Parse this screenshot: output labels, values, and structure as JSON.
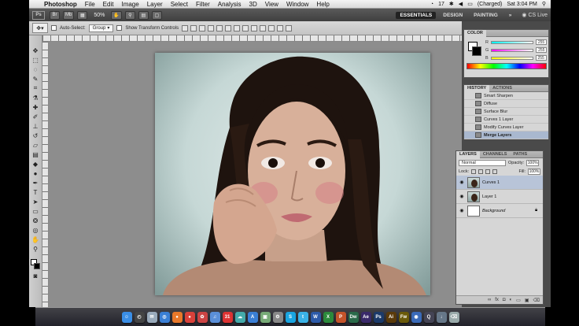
{
  "menubar": {
    "app_name": "Photoshop",
    "items": [
      "File",
      "Edit",
      "Image",
      "Layer",
      "Select",
      "Filter",
      "Analysis",
      "3D",
      "View",
      "Window",
      "Help"
    ],
    "status": {
      "badge": "17",
      "battery": "(Charged)",
      "clock": "Sat 3:04 PM"
    }
  },
  "appbar": {
    "logo": "Ps",
    "zoom": "50%",
    "workspaces": [
      "ESSENTIALS",
      "DESIGN",
      "PAINTING"
    ],
    "active_workspace": "ESSENTIALS",
    "cs_live": "CS Live"
  },
  "options": {
    "auto_select": "Auto-Select:",
    "auto_select_value": "Group",
    "show_transform": "Show Transform Controls"
  },
  "color_panel": {
    "tab": "COLOR",
    "channels": [
      {
        "name": "R",
        "value": "255"
      },
      {
        "name": "G",
        "value": "255"
      },
      {
        "name": "B",
        "value": "255"
      }
    ]
  },
  "history_panel": {
    "tabs": [
      "HISTORY",
      "ACTIONS"
    ],
    "items": [
      "Smart Sharpen",
      "Diffuse",
      "Surface Blur",
      "Curves 1 Layer",
      "Modify Curves Layer",
      "Merge Layers"
    ],
    "current": "Merge Layers"
  },
  "layers_panel": {
    "tabs": [
      "LAYERS",
      "CHANNELS",
      "PATHS"
    ],
    "blend_mode": "Normal",
    "opacity_label": "Opacity:",
    "opacity": "100%",
    "lock_label": "Lock:",
    "fill_label": "Fill:",
    "fill": "100%",
    "layers": [
      {
        "name": "Curves 1",
        "selected": true
      },
      {
        "name": "Layer 1",
        "selected": false
      },
      {
        "name": "Background",
        "selected": false
      }
    ]
  },
  "dock": {
    "apps": [
      {
        "name": "finder",
        "label": "☺",
        "color": "#3a8ee6"
      },
      {
        "name": "dashboard",
        "label": "◴",
        "color": "#444"
      },
      {
        "name": "mail",
        "label": "✉",
        "color": "#9ab"
      },
      {
        "name": "safari",
        "label": "◎",
        "color": "#3a7fd5"
      },
      {
        "name": "firefox",
        "label": "●",
        "color": "#e8782a"
      },
      {
        "name": "chrome",
        "label": "●",
        "color": "#d9413a"
      },
      {
        "name": "photos",
        "label": "✿",
        "color": "#c44"
      },
      {
        "name": "itunes",
        "label": "♫",
        "color": "#5a8fd8"
      },
      {
        "name": "calendar",
        "label": "31",
        "color": "#d33"
      },
      {
        "name": "messages",
        "label": "☁",
        "color": "#4aa"
      },
      {
        "name": "app-store",
        "label": "A",
        "color": "#3a7fd5"
      },
      {
        "name": "preview",
        "label": "▣",
        "color": "#7a7"
      },
      {
        "name": "system-prefs",
        "label": "⚙",
        "color": "#888"
      },
      {
        "name": "skype",
        "label": "S",
        "color": "#19a4e0"
      },
      {
        "name": "twitter",
        "label": "t",
        "color": "#3ab2e6"
      },
      {
        "name": "word",
        "label": "W",
        "color": "#2c5aa8"
      },
      {
        "name": "excel",
        "label": "X",
        "color": "#2c8a3c"
      },
      {
        "name": "powerpoint",
        "label": "P",
        "color": "#c4532a"
      },
      {
        "name": "dreamweaver",
        "label": "Dw",
        "color": "#2a6a4a"
      },
      {
        "name": "after-effects",
        "label": "Ae",
        "color": "#3a2a6a"
      },
      {
        "name": "photoshop",
        "label": "Ps",
        "color": "#1b3a6a"
      },
      {
        "name": "illustrator",
        "label": "Ai",
        "color": "#5a3a0a"
      },
      {
        "name": "fireworks",
        "label": "Fw",
        "color": "#6a5a0a"
      },
      {
        "name": "globe",
        "label": "◉",
        "color": "#3a6ab8"
      },
      {
        "name": "quicktime",
        "label": "Q",
        "color": "#445"
      },
      {
        "name": "downloads",
        "label": "↓",
        "color": "#678"
      },
      {
        "name": "trash",
        "label": "⌫",
        "color": "#9aa"
      }
    ]
  }
}
